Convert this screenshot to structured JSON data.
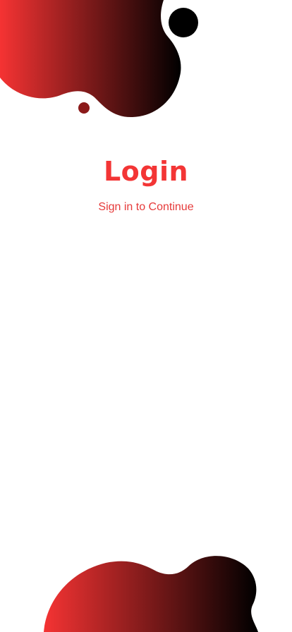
{
  "header": {
    "title": "Login",
    "subtitle": "Sign in to Continue"
  },
  "theme": {
    "accent": "#f33535",
    "gradient_start": "#f53333",
    "gradient_end": "#000000",
    "dot_dark_red": "#8b1a1a",
    "dot_black": "#000000",
    "background": "#ffffff"
  }
}
